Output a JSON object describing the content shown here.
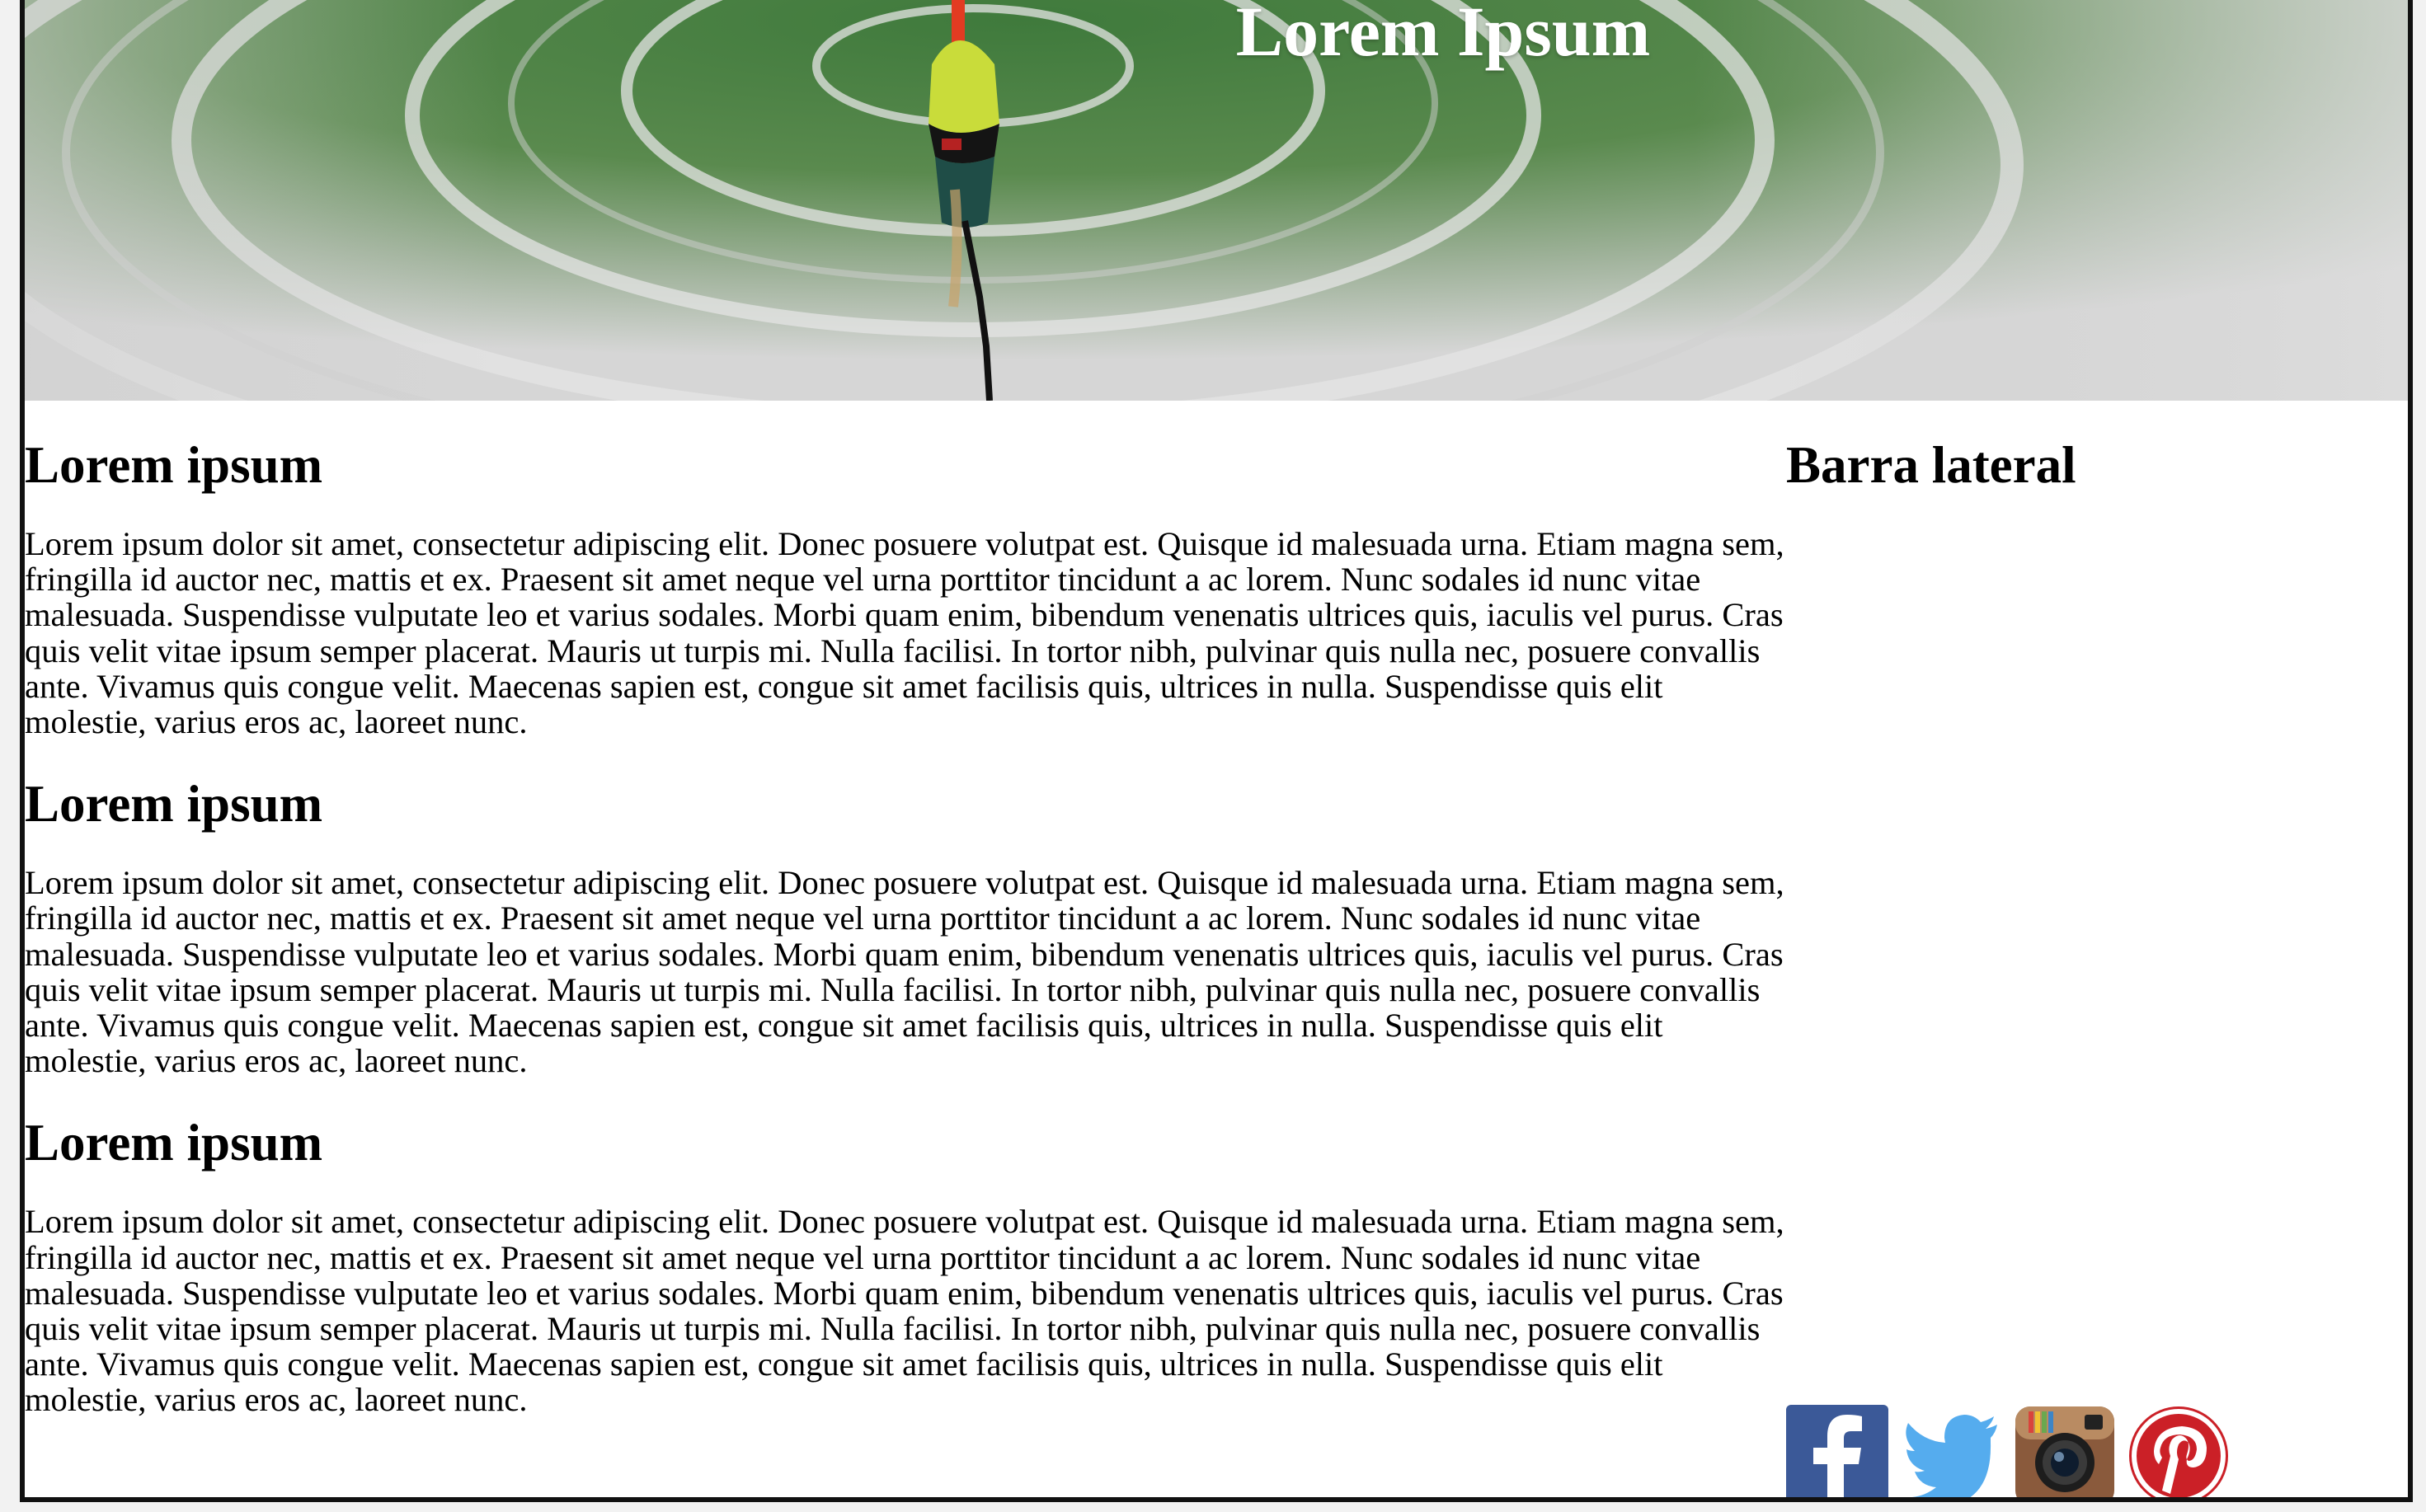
{
  "header": {
    "title": "Lorem Ipsum"
  },
  "main": {
    "sections": [
      {
        "heading": "Lorem ipsum",
        "text": "Lorem ipsum dolor sit amet, consectetur adipiscing elit. Donec posuere volutpat est. Quisque id malesuada urna. Etiam magna sem, fringilla id auctor nec, mattis et ex. Praesent sit amet neque vel urna porttitor tincidunt a ac lorem. Nunc sodales id nunc vitae malesuada. Suspendisse vulputate leo et varius sodales. Morbi quam enim, bibendum venenatis ultrices quis, iaculis vel purus. Cras quis velit vitae ipsum semper placerat. Mauris ut turpis mi. Nulla facilisi. In tortor nibh, pulvinar quis nulla nec, posuere convallis ante. Vivamus quis congue velit. Maecenas sapien est, congue sit amet facilisis quis, ultrices in nulla. Suspendisse quis elit molestie, varius eros ac, laoreet nunc."
      },
      {
        "heading": "Lorem ipsum",
        "text": "Lorem ipsum dolor sit amet, consectetur adipiscing elit. Donec posuere volutpat est. Quisque id malesuada urna. Etiam magna sem, fringilla id auctor nec, mattis et ex. Praesent sit amet neque vel urna porttitor tincidunt a ac lorem. Nunc sodales id nunc vitae malesuada. Suspendisse vulputate leo et varius sodales. Morbi quam enim, bibendum venenatis ultrices quis, iaculis vel purus. Cras quis velit vitae ipsum semper placerat. Mauris ut turpis mi. Nulla facilisi. In tortor nibh, pulvinar quis nulla nec, posuere convallis ante. Vivamus quis congue velit. Maecenas sapien est, congue sit amet facilisis quis, ultrices in nulla. Suspendisse quis elit molestie, varius eros ac, laoreet nunc."
      },
      {
        "heading": "Lorem ipsum",
        "text": "Lorem ipsum dolor sit amet, consectetur adipiscing elit. Donec posuere volutpat est. Quisque id malesuada urna. Etiam magna sem, fringilla id auctor nec, mattis et ex. Praesent sit amet neque vel urna porttitor tincidunt a ac lorem. Nunc sodales id nunc vitae malesuada. Suspendisse vulputate leo et varius sodales. Morbi quam enim, bibendum venenatis ultrices quis, iaculis vel purus. Cras quis velit vitae ipsum semper placerat. Mauris ut turpis mi. Nulla facilisi. In tortor nibh, pulvinar quis nulla nec, posuere convallis ante. Vivamus quis congue velit. Maecenas sapien est, congue sit amet facilisis quis, ultrices in nulla. Suspendisse quis elit molestie, varius eros ac, laoreet nunc."
      }
    ]
  },
  "sidebar": {
    "heading": "Barra lateral",
    "social": [
      {
        "icon": "facebook-icon",
        "letter": "f",
        "color": "#3b5998"
      },
      {
        "icon": "twitter-icon",
        "color": "#55acee"
      },
      {
        "icon": "instagram-icon",
        "color": "#8a5a3c"
      },
      {
        "icon": "pinterest-icon",
        "letter": "P",
        "color": "#cb2027"
      }
    ]
  }
}
